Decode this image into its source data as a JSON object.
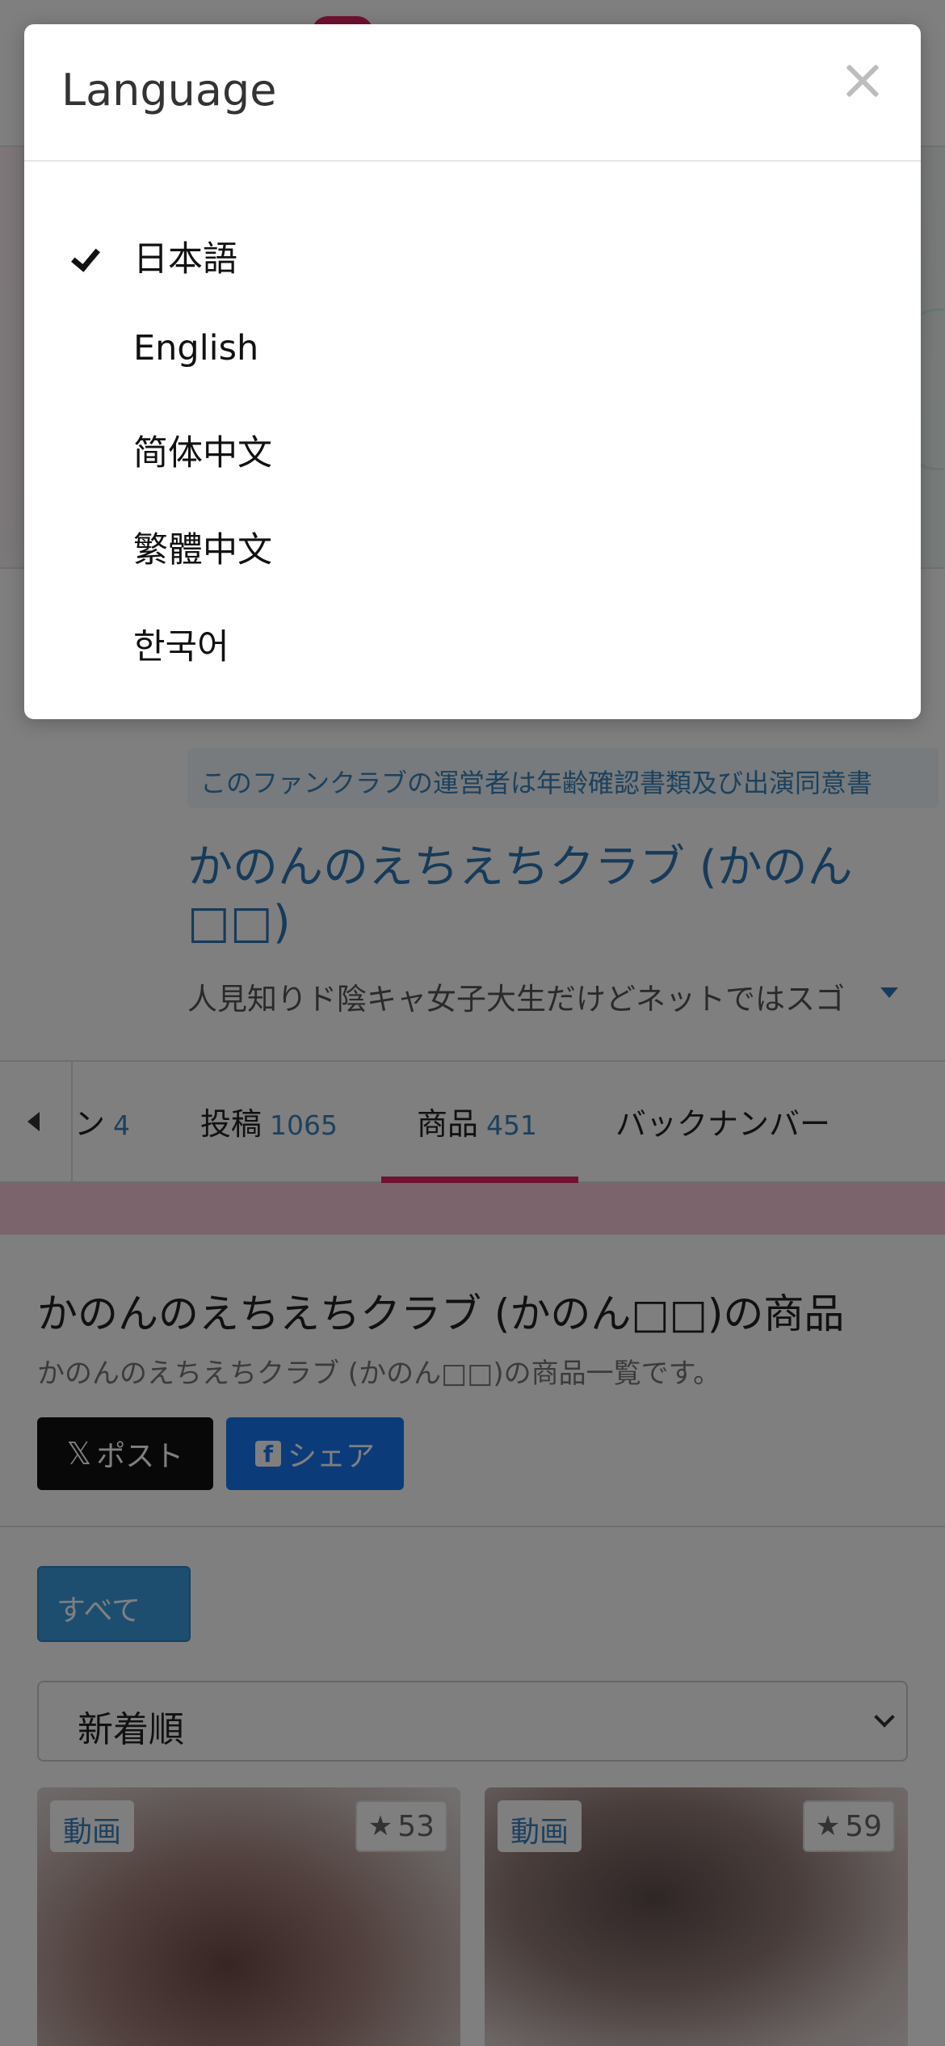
{
  "background": {
    "notice": "このファンクラブの運営者は年齢確認書類及び出演同意書",
    "club_title": "かのんのえちえちクラブ (かのん□□)",
    "club_description": "人見知りド陰キャ女子大生だけどネットではスゴ",
    "tabs": [
      {
        "label": "ン",
        "count": "4"
      },
      {
        "label": "投稿",
        "count": "1065"
      },
      {
        "label": "商品",
        "count": "451",
        "active": true
      },
      {
        "label": "バックナンバー",
        "count": ""
      }
    ],
    "section_title": "かのんのえちえちクラブ (かのん□□)の商品",
    "section_description": "かのんのえちえちクラブ (かのん□□)の商品一覧です。",
    "post_button": "ポスト",
    "share_button": "シェア",
    "filter_all": "すべて",
    "sort_selected": "新着順",
    "cards": [
      {
        "tag": "動画",
        "rating": "53"
      },
      {
        "tag": "動画",
        "rating": "59"
      }
    ]
  },
  "modal": {
    "title": "Language",
    "languages": [
      {
        "label": "日本語",
        "selected": true
      },
      {
        "label": "English",
        "selected": false
      },
      {
        "label": "简体中文",
        "selected": false
      },
      {
        "label": "繁體中文",
        "selected": false
      },
      {
        "label": "한국어",
        "selected": false
      }
    ]
  },
  "colors": {
    "accent_pink": "#e0245e",
    "link_blue": "#2f77b5",
    "facebook_blue": "#1877f2",
    "filter_blue": "#3b9de0"
  }
}
